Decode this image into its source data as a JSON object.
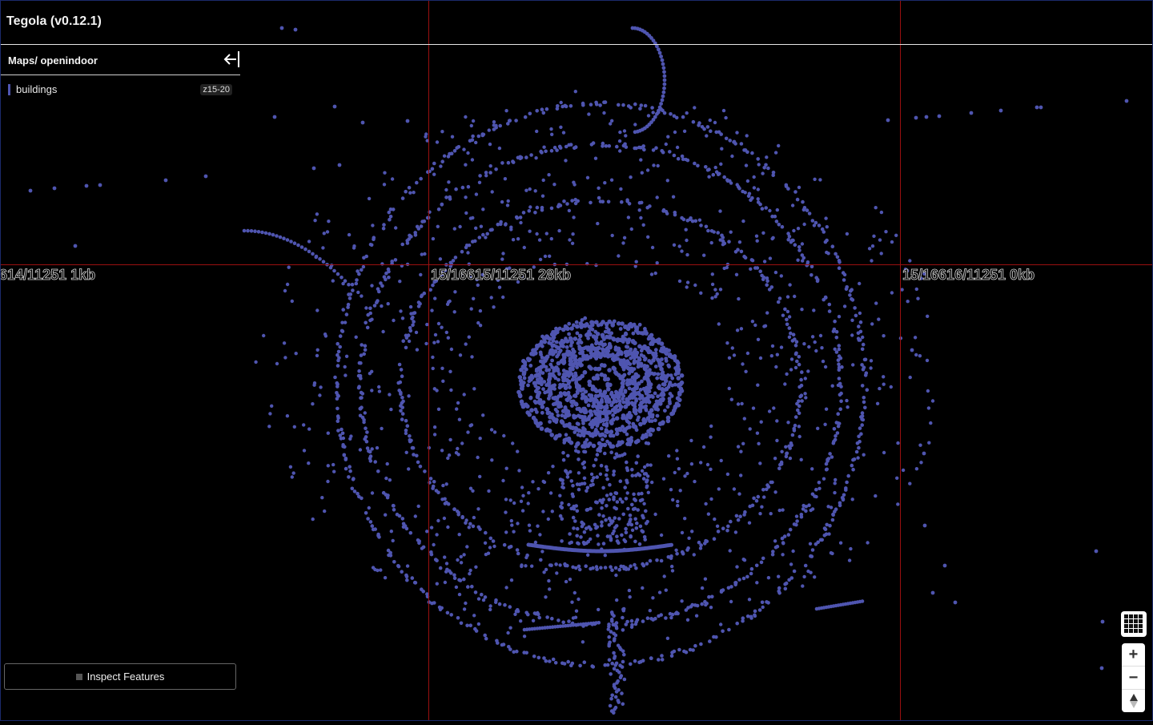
{
  "app": {
    "title": "Tegola (v0.12.1)"
  },
  "sidebar": {
    "title": "Maps/ openindoor",
    "back_icon": "arrow-left-icon",
    "layers": [
      {
        "name": "buildings",
        "zoom_range": "z15-20",
        "color": "#4f55b0"
      }
    ],
    "inspect_label": "Inspect Features"
  },
  "tiles": {
    "labels": [
      "614/11251 1kb",
      "15/16615/11251 28kb",
      "15/16616/11251 0kb"
    ],
    "boundary_color": "#9a1010",
    "label_text_color": "#000000"
  },
  "map": {
    "background": "#000000",
    "feature_color": "#4f55b0",
    "feature_type": "points"
  },
  "controls": {
    "grid_icon": "grid-icon",
    "zoom_in": "+",
    "zoom_out": "−",
    "compass_icon": "compass-icon"
  }
}
